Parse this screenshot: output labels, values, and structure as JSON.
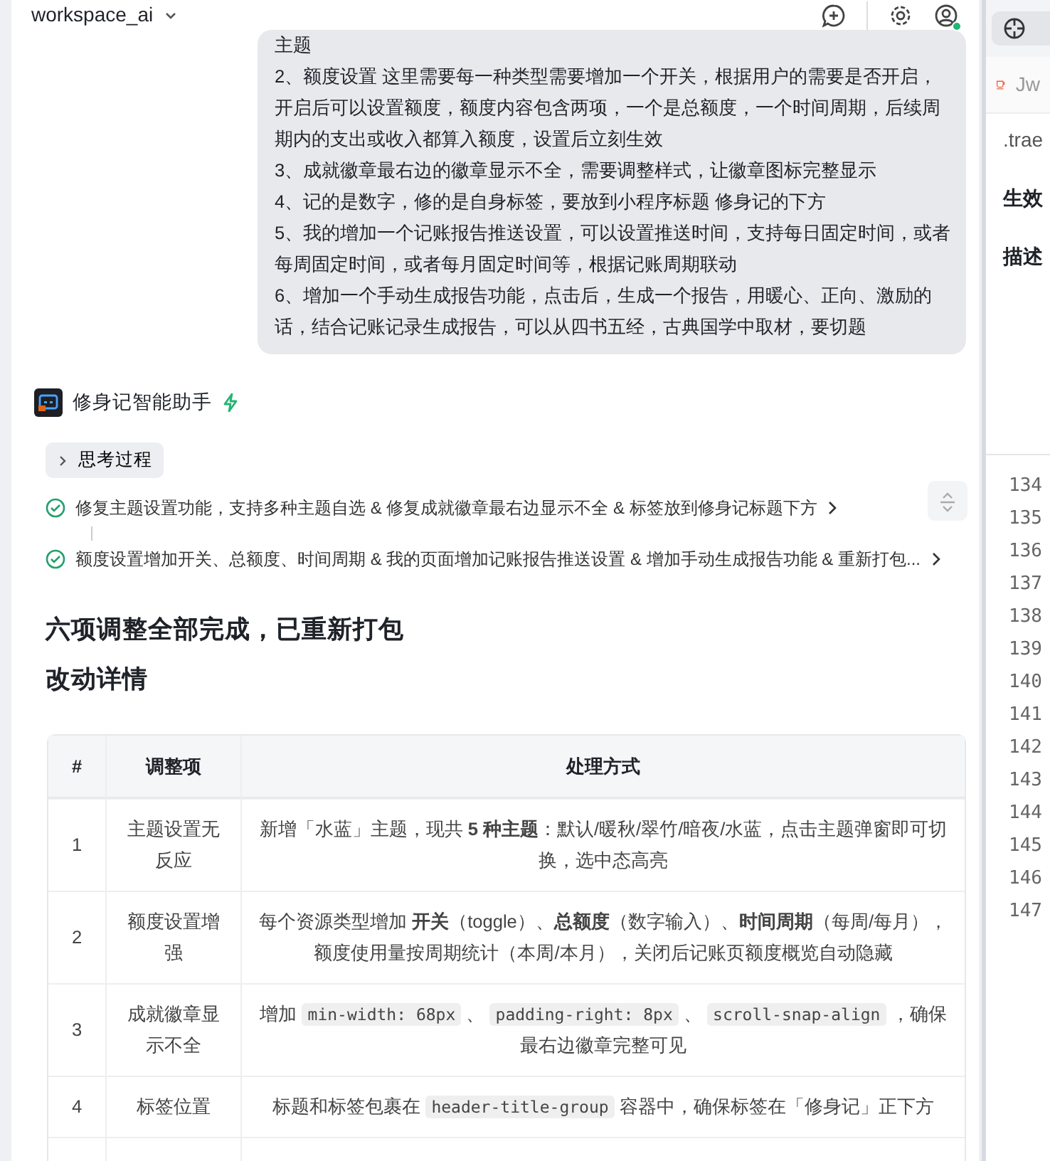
{
  "header": {
    "workspace": "workspace_ai",
    "status_online": true
  },
  "user_message": {
    "lines": [
      "主题",
      "2、额度设置 这里需要每一种类型需要增加一个开关，根据用户的需要是否开启，开启后可以设置额度，额度内容包含两项，一个是总额度，一个时间周期，后续周期内的支出或收入都算入额度，设置后立刻生效",
      "3、成就徽章最右边的徽章显示不全，需要调整样式，让徽章图标完整显示",
      "4、记的是数字，修的是自身标签，要放到小程序标题 修身记的下方",
      "5、我的增加一个记账报告推送设置，可以设置推送时间，支持每日固定时间，或者每周固定时间，或者每月固定时间等，根据记账周期联动",
      "6、增加一个手动生成报告功能，点击后，生成一个报告，用暖心、正向、激励的话，结合记账记录生成报告，可以从四书五经，古典国学中取材，要切题"
    ]
  },
  "assistant": {
    "name": "修身记智能助手"
  },
  "thinking": {
    "label": "思考过程",
    "expanded": false
  },
  "steps": [
    {
      "text": "修复主题设置功能，支持多种主题自选 & 修复成就徽章最右边显示不全 & 标签放到修身记标题下方",
      "done": true
    },
    {
      "text": "额度设置增加开关、总额度、时间周期 & 我的页面增加记账报告推送设置 & 增加手动生成报告功能 & 重新打包...",
      "done": true
    }
  ],
  "headings": [
    "六项调整全部完成，已重新打包",
    "改动详情"
  ],
  "table": {
    "columns": [
      "#",
      "调整项",
      "处理方式"
    ],
    "rows": [
      {
        "cells": [
          "1",
          "主题设置无反应"
        ],
        "detail": [
          {
            "kind": "text",
            "text": "新增「水蓝」主题，现共 **5 种主题**：默认/暖秋/翠竹/暗夜/水蓝，点击主题弹窗即可切换，选中态高亮"
          }
        ]
      },
      {
        "cells": [
          "2",
          "额度设置增强"
        ],
        "detail": [
          {
            "kind": "text",
            "text": "每个资源类型增加 **开关**（toggle）、**总额度**（数字输入）、**时间周期**（每周/每月），额度使用量按周期统计（本周/本月），关闭后记账页额度概览自动隐藏"
          }
        ]
      },
      {
        "cells": [
          "3",
          "成就徽章显示不全"
        ],
        "detail": [
          {
            "kind": "text",
            "text": "增加 "
          },
          {
            "kind": "code",
            "text": "min-width: 68px"
          },
          {
            "kind": "text",
            "text": " 、 "
          },
          {
            "kind": "code",
            "text": "padding-right: 8px"
          },
          {
            "kind": "text",
            "text": " 、 "
          },
          {
            "kind": "code",
            "text": "scroll-snap-align"
          },
          {
            "kind": "text",
            "text": " ，确保最右边徽章完整可见"
          }
        ]
      },
      {
        "cells": [
          "4",
          "标签位置"
        ],
        "detail": [
          {
            "kind": "text",
            "text": "标题和标签包裹在 "
          },
          {
            "kind": "code",
            "text": "header-title-group"
          },
          {
            "kind": "text",
            "text": " 容器中，确保标签在「修身记」正下方"
          }
        ]
      }
    ]
  },
  "side_panel": {
    "tab": "Jw",
    "path": ".trae",
    "labels": [
      "生效",
      "描述"
    ],
    "line_numbers": [
      "134",
      "135",
      "136",
      "137",
      "138",
      "139",
      "140",
      "141",
      "142",
      "143",
      "144",
      "145",
      "146",
      "147"
    ]
  }
}
